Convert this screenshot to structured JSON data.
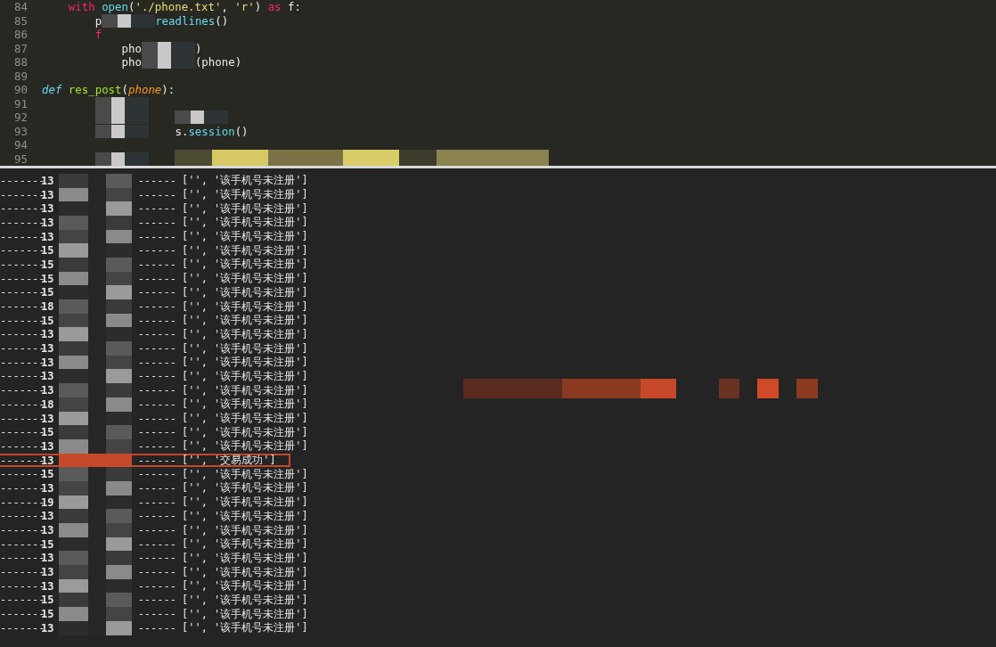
{
  "editor": {
    "lines": [
      {
        "number": "84",
        "tokens": [
          {
            "kind": "tab"
          },
          {
            "kind": "keyword",
            "text": "with"
          },
          {
            "kind": "space"
          },
          {
            "kind": "builtin",
            "text": "open"
          },
          {
            "kind": "plain",
            "text": "("
          },
          {
            "kind": "string",
            "text": "'./phone.txt'"
          },
          {
            "kind": "plain",
            "text": ","
          },
          {
            "kind": "space"
          },
          {
            "kind": "string",
            "text": "'r'"
          },
          {
            "kind": "plain",
            "text": ")"
          },
          {
            "kind": "space"
          },
          {
            "kind": "keyword",
            "text": "as"
          },
          {
            "kind": "space"
          },
          {
            "kind": "plain",
            "text": "f:"
          }
        ]
      },
      {
        "number": "85",
        "tokens": [
          {
            "kind": "tab"
          },
          {
            "kind": "tab"
          },
          {
            "kind": "plain",
            "text": "p"
          },
          {
            "kind": "redaction"
          },
          {
            "kind": "builtin",
            "text": "readlines"
          },
          {
            "kind": "plain",
            "text": "()"
          }
        ]
      },
      {
        "number": "86",
        "tokens": [
          {
            "kind": "tab"
          },
          {
            "kind": "tab"
          },
          {
            "kind": "keyword",
            "text": "f"
          }
        ]
      },
      {
        "number": "87",
        "tokens": [
          {
            "kind": "tab"
          },
          {
            "kind": "tab"
          },
          {
            "kind": "tab"
          },
          {
            "kind": "plain",
            "text": "pho"
          },
          {
            "kind": "redaction"
          },
          {
            "kind": "plain",
            "text": ")"
          }
        ]
      },
      {
        "number": "88",
        "tokens": [
          {
            "kind": "tab"
          },
          {
            "kind": "tab"
          },
          {
            "kind": "tab"
          },
          {
            "kind": "plain",
            "text": "pho"
          },
          {
            "kind": "redaction"
          },
          {
            "kind": "plain",
            "text": "(phone)"
          }
        ]
      },
      {
        "number": "89"
      },
      {
        "number": "90",
        "tokens": [
          {
            "kind": "storage",
            "text": "def"
          },
          {
            "kind": "space"
          },
          {
            "kind": "function",
            "text": "res_post"
          },
          {
            "kind": "plain",
            "text": "("
          },
          {
            "kind": "param",
            "text": "phone"
          },
          {
            "kind": "plain",
            "text": "):"
          }
        ]
      },
      {
        "number": "91",
        "tokens": [
          {
            "kind": "tab"
          },
          {
            "kind": "tab"
          },
          {
            "kind": "redaction"
          }
        ]
      },
      {
        "number": "92",
        "tokens": [
          {
            "kind": "tab"
          },
          {
            "kind": "tab"
          },
          {
            "kind": "redaction"
          },
          {
            "kind": "tab"
          },
          {
            "kind": "redaction"
          }
        ]
      },
      {
        "number": "93",
        "tokens": [
          {
            "kind": "tab"
          },
          {
            "kind": "tab"
          },
          {
            "kind": "redaction"
          },
          {
            "kind": "tab"
          },
          {
            "kind": "plain",
            "text": "s."
          },
          {
            "kind": "builtin",
            "text": "session"
          },
          {
            "kind": "plain",
            "text": "()"
          }
        ]
      },
      {
        "number": "94"
      },
      {
        "number": "95",
        "tokens": [
          {
            "kind": "tab"
          },
          {
            "kind": "tab"
          },
          {
            "kind": "redaction"
          },
          {
            "kind": "tab"
          },
          {
            "kind": "redaction_yellow"
          }
        ]
      }
    ]
  },
  "output": {
    "rows": [
      {
        "lead": "-------",
        "number": "13",
        "sep": "------",
        "result": "['', '该手机号未注册']",
        "highlighted": false
      },
      {
        "lead": "-------",
        "number": "13",
        "sep": "------",
        "result": "['', '该手机号未注册']",
        "highlighted": false
      },
      {
        "lead": "-------",
        "number": "13",
        "sep": "------",
        "result": "['', '该手机号未注册']",
        "highlighted": false
      },
      {
        "lead": "-------",
        "number": "13",
        "sep": "------",
        "result": "['', '该手机号未注册']",
        "highlighted": false
      },
      {
        "lead": "-------",
        "number": "13",
        "sep": "------",
        "result": "['', '该手机号未注册']",
        "highlighted": false
      },
      {
        "lead": "-------",
        "number": "15",
        "sep": "------",
        "result": "['', '该手机号未注册']",
        "highlighted": false
      },
      {
        "lead": "-------",
        "number": "15",
        "sep": "------",
        "result": "['', '该手机号未注册']",
        "highlighted": false
      },
      {
        "lead": "-------",
        "number": "15",
        "sep": "------",
        "result": "['', '该手机号未注册']",
        "highlighted": false
      },
      {
        "lead": "-------",
        "number": "15",
        "sep": "------",
        "result": "['', '该手机号未注册']",
        "highlighted": false
      },
      {
        "lead": "-------",
        "number": "18",
        "sep": "------",
        "result": "['', '该手机号未注册']",
        "highlighted": false
      },
      {
        "lead": "-------",
        "number": "15",
        "sep": "------",
        "result": "['', '该手机号未注册']",
        "highlighted": false
      },
      {
        "lead": "-------",
        "number": "13",
        "sep": "------",
        "result": "['', '该手机号未注册']",
        "highlighted": false
      },
      {
        "lead": "-------",
        "number": "13",
        "sep": "------",
        "result": "['', '该手机号未注册']",
        "highlighted": false
      },
      {
        "lead": "-------",
        "number": "13",
        "sep": "------",
        "result": "['', '该手机号未注册']",
        "highlighted": false
      },
      {
        "lead": "-------",
        "number": "13",
        "sep": "------",
        "result": "['', '该手机号未注册']",
        "highlighted": false
      },
      {
        "lead": "-------",
        "number": "13",
        "sep": "------",
        "result": "['', '该手机号未注册']",
        "highlighted": false
      },
      {
        "lead": "-------",
        "number": "18",
        "sep": "------",
        "result": "['', '该手机号未注册']",
        "highlighted": false
      },
      {
        "lead": "-------",
        "number": "13",
        "sep": "------",
        "result": "['', '该手机号未注册']",
        "highlighted": false
      },
      {
        "lead": "-------",
        "number": "15",
        "sep": "------",
        "result": "['', '该手机号未注册']",
        "highlighted": false
      },
      {
        "lead": "-------",
        "number": "13",
        "sep": "------",
        "result": "['', '该手机号未注册']",
        "highlighted": false
      },
      {
        "lead": "-------",
        "number": "13",
        "sep": "------",
        "result": "['', '交易成功']",
        "highlighted": true
      },
      {
        "lead": "-------",
        "number": "15",
        "sep": "------",
        "result": "['', '该手机号未注册']",
        "highlighted": false
      },
      {
        "lead": "-------",
        "number": "13",
        "sep": "------",
        "result": "['', '该手机号未注册']",
        "highlighted": false
      },
      {
        "lead": "-------",
        "number": "19",
        "sep": "------",
        "result": "['', '该手机号未注册']",
        "highlighted": false
      },
      {
        "lead": "-------",
        "number": "13",
        "sep": "------",
        "result": "['', '该手机号未注册']",
        "highlighted": false
      },
      {
        "lead": "-------",
        "number": "13",
        "sep": "------",
        "result": "['', '该手机号未注册']",
        "highlighted": false
      },
      {
        "lead": "-------",
        "number": "15",
        "sep": "------",
        "result": "['', '该手机号未注册']",
        "highlighted": false
      },
      {
        "lead": "-------",
        "number": "13",
        "sep": "------",
        "result": "['', '该手机号未注册']",
        "highlighted": false
      },
      {
        "lead": "-------",
        "number": "13",
        "sep": "------",
        "result": "['', '该手机号未注册']",
        "highlighted": false
      },
      {
        "lead": "-------",
        "number": "13",
        "sep": "------",
        "result": "['', '该手机号未注册']",
        "highlighted": false
      },
      {
        "lead": "-------",
        "number": "15",
        "sep": "------",
        "result": "['', '该手机号未注册']",
        "highlighted": false
      },
      {
        "lead": "-------",
        "number": "15",
        "sep": "------",
        "result": "['', '该手机号未注册']",
        "highlighted": false
      },
      {
        "lead": "-------",
        "number": "13",
        "sep": "------",
        "result": "['', '该手机号未注册']",
        "highlighted": false
      }
    ]
  }
}
